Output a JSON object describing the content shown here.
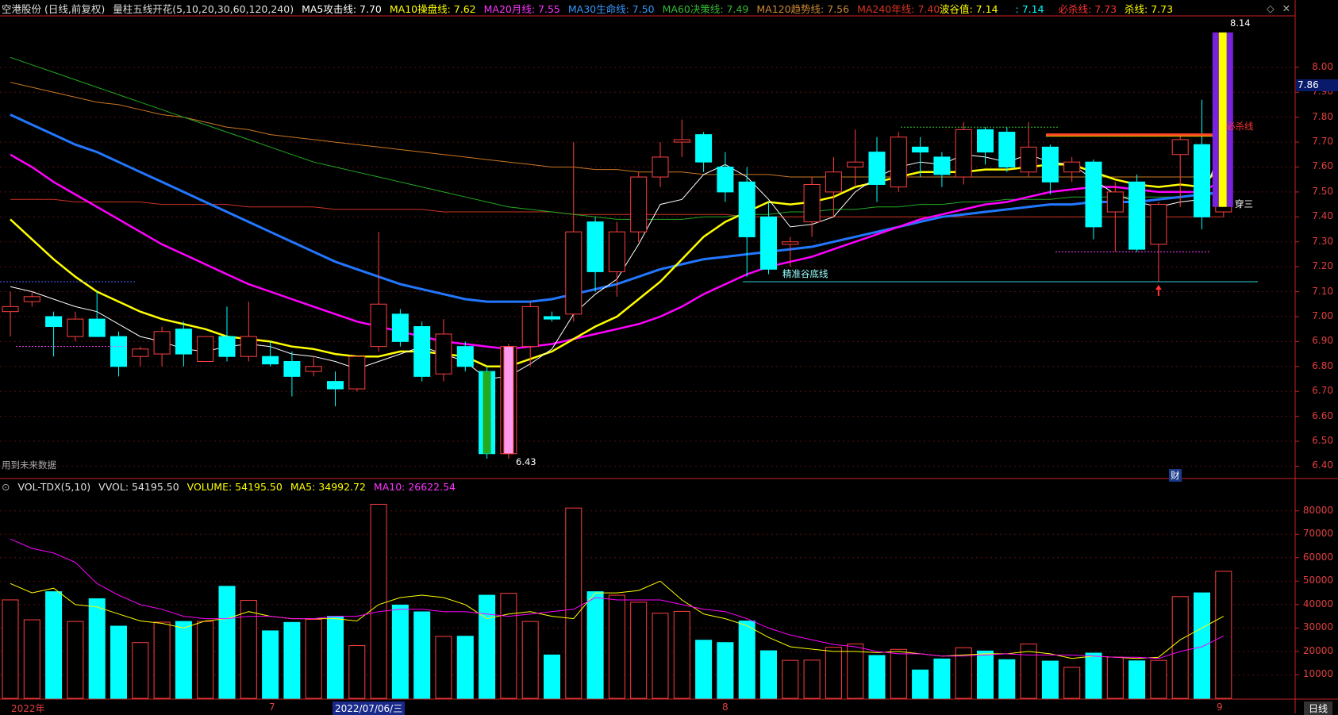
{
  "main_header": {
    "stock": "空港股份 (日线,前复权)",
    "indicator": "量柱五线开花(5,10,20,30,60,120,240)",
    "ma5": "MA5攻击线: 7.70",
    "ma10": "MA10操盘线: 7.62",
    "ma20": "MA20月线: 7.55",
    "ma30": "MA30生命线: 7.50",
    "ma60": "MA60决策线: 7.49",
    "ma120": "MA120趋势线: 7.56",
    "ma240": "MA240年线: 7.40",
    "wave_value": "波谷值: 7.14",
    "blank_value": ": 7.14",
    "must_kill": "必杀线: 7.73",
    "kill": "杀线: 7.73"
  },
  "vol_header": {
    "name": "VOL-TDX(5,10)",
    "vvol": "VVOL: 54195.50",
    "volume": "VOLUME: 54195.50",
    "ma5": "MA5: 34992.72",
    "ma10": "MA10: 26622.54"
  },
  "price_axis": [
    "8.00",
    "7.90",
    "7.80",
    "7.70",
    "7.60",
    "7.50",
    "7.40",
    "7.30",
    "7.20",
    "7.10",
    "7.00",
    "6.90",
    "6.80",
    "6.70",
    "6.60",
    "6.50",
    "6.40"
  ],
  "current_price": "7.86",
  "vol_axis": [
    "80000",
    "70000",
    "60000",
    "50000",
    "40000",
    "30000",
    "20000",
    "10000"
  ],
  "annotations": {
    "high": "8.14",
    "low": "6.43",
    "must_kill_line": "必杀线",
    "cross_three": "穿三",
    "valley_line": "精准谷底线",
    "future_data": "用到未来数据",
    "finance": "财"
  },
  "date_labels": {
    "year": "2022年",
    "july": "7",
    "cursor_date": "2022/07/06/三",
    "aug": "8",
    "sep": "9"
  },
  "tab_label": "日线",
  "colors": {
    "up": "#ff4040",
    "down": "#00ffff",
    "ma5": "#ffffff",
    "ma10": "#ffff00",
    "ma20": "#ff00ff",
    "ma30": "#2277ff",
    "ma60": "#22aa22",
    "ma120": "#cc7722",
    "ma240": "#cc3322",
    "axis": "#cc2222"
  },
  "chart_data": {
    "type": "candlestick",
    "price_range": [
      6.36,
      8.2
    ],
    "volume_range": [
      0,
      86000
    ],
    "candles": [
      {
        "o": 7.02,
        "h": 7.1,
        "l": 6.92,
        "c": 7.04,
        "v": 42000
      },
      {
        "o": 7.06,
        "h": 7.1,
        "l": 7.04,
        "c": 7.08,
        "v": 33500
      },
      {
        "o": 7.0,
        "h": 7.02,
        "l": 6.84,
        "c": 6.96,
        "v": 45500
      },
      {
        "o": 6.92,
        "h": 7.02,
        "l": 6.9,
        "c": 6.99,
        "v": 32800
      },
      {
        "o": 6.99,
        "h": 7.1,
        "l": 6.92,
        "c": 6.92,
        "v": 42500
      },
      {
        "o": 6.92,
        "h": 6.94,
        "l": 6.76,
        "c": 6.8,
        "v": 30800
      },
      {
        "o": 6.84,
        "h": 6.88,
        "l": 6.8,
        "c": 6.87,
        "v": 23800
      },
      {
        "o": 6.85,
        "h": 6.96,
        "l": 6.8,
        "c": 6.94,
        "v": 32500
      },
      {
        "o": 6.95,
        "h": 6.98,
        "l": 6.8,
        "c": 6.85,
        "v": 32800
      },
      {
        "o": 6.82,
        "h": 6.92,
        "l": 6.82,
        "c": 6.92,
        "v": 32800
      },
      {
        "o": 6.92,
        "h": 7.04,
        "l": 6.82,
        "c": 6.84,
        "v": 47800
      },
      {
        "o": 6.84,
        "h": 7.06,
        "l": 6.82,
        "c": 6.92,
        "v": 41800
      },
      {
        "o": 6.84,
        "h": 6.9,
        "l": 6.8,
        "c": 6.81,
        "v": 28800
      },
      {
        "o": 6.82,
        "h": 6.86,
        "l": 6.68,
        "c": 6.76,
        "v": 32400
      },
      {
        "o": 6.78,
        "h": 6.84,
        "l": 6.76,
        "c": 6.8,
        "v": 33700
      },
      {
        "o": 6.74,
        "h": 6.78,
        "l": 6.64,
        "c": 6.71,
        "v": 35000
      },
      {
        "o": 6.71,
        "h": 6.84,
        "l": 6.7,
        "c": 6.84,
        "v": 22500
      },
      {
        "o": 6.88,
        "h": 7.34,
        "l": 6.86,
        "c": 7.05,
        "v": 82800
      },
      {
        "o": 7.01,
        "h": 7.03,
        "l": 6.88,
        "c": 6.9,
        "v": 39800
      },
      {
        "o": 6.96,
        "h": 6.98,
        "l": 6.74,
        "c": 6.76,
        "v": 36900
      },
      {
        "o": 6.77,
        "h": 6.99,
        "l": 6.74,
        "c": 6.93,
        "v": 26400
      },
      {
        "o": 6.88,
        "h": 6.9,
        "l": 6.78,
        "c": 6.8,
        "v": 26500
      },
      {
        "o": 6.78,
        "h": 6.8,
        "l": 6.43,
        "c": 6.45,
        "v": 44000
      },
      {
        "o": 6.45,
        "h": 6.89,
        "l": 6.43,
        "c": 6.88,
        "v": 44800
      },
      {
        "o": 6.88,
        "h": 7.06,
        "l": 6.8,
        "c": 7.04,
        "v": 32800
      },
      {
        "o": 7.0,
        "h": 7.02,
        "l": 6.98,
        "c": 6.99,
        "v": 18500
      },
      {
        "o": 7.01,
        "h": 7.7,
        "l": 6.98,
        "c": 7.34,
        "v": 81200
      },
      {
        "o": 7.38,
        "h": 7.4,
        "l": 7.1,
        "c": 7.18,
        "v": 45500
      },
      {
        "o": 7.18,
        "h": 7.38,
        "l": 7.08,
        "c": 7.34,
        "v": 44000
      },
      {
        "o": 7.34,
        "h": 7.58,
        "l": 7.3,
        "c": 7.56,
        "v": 41000
      },
      {
        "o": 7.56,
        "h": 7.7,
        "l": 7.52,
        "c": 7.64,
        "v": 36300
      },
      {
        "o": 7.7,
        "h": 7.79,
        "l": 7.64,
        "c": 7.71,
        "v": 37100
      },
      {
        "o": 7.73,
        "h": 7.74,
        "l": 7.58,
        "c": 7.62,
        "v": 24800
      },
      {
        "o": 7.6,
        "h": 7.66,
        "l": 7.46,
        "c": 7.5,
        "v": 23800
      },
      {
        "o": 7.54,
        "h": 7.6,
        "l": 7.16,
        "c": 7.32,
        "v": 33000
      },
      {
        "o": 7.4,
        "h": 7.46,
        "l": 7.17,
        "c": 7.19,
        "v": 20300
      },
      {
        "o": 7.29,
        "h": 7.32,
        "l": 7.2,
        "c": 7.3,
        "v": 16200
      },
      {
        "o": 7.38,
        "h": 7.56,
        "l": 7.32,
        "c": 7.53,
        "v": 16300
      },
      {
        "o": 7.5,
        "h": 7.64,
        "l": 7.4,
        "c": 7.58,
        "v": 21800
      },
      {
        "o": 7.6,
        "h": 7.75,
        "l": 7.52,
        "c": 7.62,
        "v": 23200
      },
      {
        "o": 7.66,
        "h": 7.72,
        "l": 7.46,
        "c": 7.53,
        "v": 18300
      },
      {
        "o": 7.52,
        "h": 7.74,
        "l": 7.5,
        "c": 7.72,
        "v": 20900
      },
      {
        "o": 7.68,
        "h": 7.72,
        "l": 7.56,
        "c": 7.66,
        "v": 12100
      },
      {
        "o": 7.64,
        "h": 7.66,
        "l": 7.52,
        "c": 7.57,
        "v": 16800
      },
      {
        "o": 7.56,
        "h": 7.78,
        "l": 7.53,
        "c": 7.75,
        "v": 21600
      },
      {
        "o": 7.75,
        "h": 7.76,
        "l": 7.61,
        "c": 7.66,
        "v": 20200
      },
      {
        "o": 7.74,
        "h": 7.76,
        "l": 7.58,
        "c": 7.6,
        "v": 16500
      },
      {
        "o": 7.58,
        "h": 7.78,
        "l": 7.56,
        "c": 7.68,
        "v": 23200
      },
      {
        "o": 7.68,
        "h": 7.69,
        "l": 7.49,
        "c": 7.54,
        "v": 15900
      },
      {
        "o": 7.58,
        "h": 7.64,
        "l": 7.54,
        "c": 7.62,
        "v": 13200
      },
      {
        "o": 7.62,
        "h": 7.63,
        "l": 7.31,
        "c": 7.36,
        "v": 19300
      },
      {
        "o": 7.42,
        "h": 7.54,
        "l": 7.26,
        "c": 7.5,
        "v": 17600
      },
      {
        "o": 7.54,
        "h": 7.57,
        "l": 7.26,
        "c": 7.27,
        "v": 16000
      },
      {
        "o": 7.29,
        "h": 7.46,
        "l": 7.14,
        "c": 7.45,
        "v": 16200
      },
      {
        "o": 7.65,
        "h": 7.73,
        "l": 7.44,
        "c": 7.71,
        "v": 43400
      },
      {
        "o": 7.69,
        "h": 7.87,
        "l": 7.35,
        "c": 7.4,
        "v": 45000
      },
      {
        "o": 7.42,
        "h": 8.14,
        "l": 7.4,
        "c": 8.13,
        "v": 54195.5
      }
    ],
    "ma5": [
      7.12,
      7.1,
      7.07,
      7.04,
      7.02,
      6.97,
      6.92,
      6.9,
      6.87,
      6.86,
      6.88,
      6.89,
      6.88,
      6.85,
      6.84,
      6.82,
      6.79,
      6.82,
      6.85,
      6.88,
      6.85,
      6.82,
      6.75,
      6.76,
      6.81,
      6.87,
      7.01,
      7.09,
      7.15,
      7.29,
      7.45,
      7.47,
      7.57,
      7.61,
      7.56,
      7.47,
      7.36,
      7.37,
      7.4,
      7.5,
      7.56,
      7.6,
      7.62,
      7.61,
      7.65,
      7.64,
      7.62,
      7.65,
      7.62,
      7.61,
      7.55,
      7.49,
      7.46,
      7.44,
      7.46,
      7.47,
      7.7
    ],
    "ma10": [
      7.39,
      7.31,
      7.23,
      7.16,
      7.1,
      7.06,
      7.02,
      6.99,
      6.97,
      6.95,
      6.92,
      6.91,
      6.9,
      6.88,
      6.87,
      6.85,
      6.84,
      6.84,
      6.86,
      6.86,
      6.85,
      6.84,
      6.8,
      6.8,
      6.83,
      6.86,
      6.91,
      6.96,
      7.0,
      7.07,
      7.14,
      7.23,
      7.32,
      7.38,
      7.42,
      7.46,
      7.45,
      7.46,
      7.48,
      7.52,
      7.54,
      7.56,
      7.58,
      7.58,
      7.58,
      7.59,
      7.59,
      7.6,
      7.61,
      7.61,
      7.58,
      7.55,
      7.53,
      7.52,
      7.53,
      7.52,
      7.62
    ],
    "ma20": [
      7.65,
      7.6,
      7.54,
      7.49,
      7.44,
      7.39,
      7.34,
      7.29,
      7.25,
      7.21,
      7.17,
      7.13,
      7.1,
      7.07,
      7.04,
      7.01,
      6.98,
      6.96,
      6.94,
      6.92,
      6.9,
      6.89,
      6.88,
      6.87,
      6.88,
      6.89,
      6.91,
      6.93,
      6.95,
      6.97,
      7.0,
      7.04,
      7.09,
      7.13,
      7.17,
      7.2,
      7.22,
      7.24,
      7.27,
      7.3,
      7.33,
      7.36,
      7.39,
      7.41,
      7.43,
      7.45,
      7.46,
      7.48,
      7.5,
      7.51,
      7.52,
      7.52,
      7.51,
      7.5,
      7.5,
      7.5,
      7.55
    ],
    "ma30": [
      7.81,
      7.77,
      7.73,
      7.69,
      7.66,
      7.62,
      7.58,
      7.54,
      7.5,
      7.46,
      7.42,
      7.38,
      7.34,
      7.3,
      7.26,
      7.22,
      7.19,
      7.16,
      7.13,
      7.11,
      7.09,
      7.07,
      7.06,
      7.06,
      7.06,
      7.07,
      7.09,
      7.11,
      7.13,
      7.16,
      7.19,
      7.21,
      7.23,
      7.24,
      7.25,
      7.26,
      7.27,
      7.28,
      7.3,
      7.32,
      7.34,
      7.36,
      7.38,
      7.4,
      7.41,
      7.42,
      7.43,
      7.44,
      7.45,
      7.45,
      7.46,
      7.46,
      7.46,
      7.47,
      7.48,
      7.49,
      7.5
    ],
    "ma60": [
      8.04,
      8.01,
      7.98,
      7.95,
      7.92,
      7.89,
      7.86,
      7.83,
      7.8,
      7.77,
      7.74,
      7.71,
      7.68,
      7.65,
      7.62,
      7.6,
      7.58,
      7.56,
      7.54,
      7.52,
      7.5,
      7.48,
      7.46,
      7.44,
      7.43,
      7.42,
      7.41,
      7.4,
      7.39,
      7.39,
      7.39,
      7.39,
      7.4,
      7.4,
      7.41,
      7.41,
      7.42,
      7.42,
      7.43,
      7.43,
      7.44,
      7.44,
      7.45,
      7.45,
      7.46,
      7.46,
      7.47,
      7.47,
      7.47,
      7.48,
      7.48,
      7.48,
      7.48,
      7.48,
      7.48,
      7.49,
      7.49
    ],
    "ma120": [
      7.94,
      7.92,
      7.9,
      7.88,
      7.86,
      7.85,
      7.83,
      7.81,
      7.8,
      7.78,
      7.76,
      7.75,
      7.73,
      7.72,
      7.71,
      7.7,
      7.69,
      7.68,
      7.67,
      7.66,
      7.65,
      7.64,
      7.63,
      7.62,
      7.61,
      7.6,
      7.6,
      7.59,
      7.59,
      7.58,
      7.58,
      7.58,
      7.57,
      7.57,
      7.57,
      7.57,
      7.56,
      7.56,
      7.56,
      7.56,
      7.56,
      7.56,
      7.56,
      7.56,
      7.56,
      7.56,
      7.56,
      7.56,
      7.56,
      7.56,
      7.56,
      7.56,
      7.56,
      7.56,
      7.56,
      7.56,
      7.56
    ],
    "ma240": [
      7.47,
      7.47,
      7.47,
      7.46,
      7.46,
      7.46,
      7.46,
      7.45,
      7.45,
      7.45,
      7.45,
      7.44,
      7.44,
      7.44,
      7.44,
      7.43,
      7.43,
      7.43,
      7.43,
      7.43,
      7.42,
      7.42,
      7.42,
      7.42,
      7.42,
      7.42,
      7.41,
      7.41,
      7.41,
      7.41,
      7.41,
      7.41,
      7.41,
      7.41,
      7.4,
      7.4,
      7.4,
      7.4,
      7.4,
      7.4,
      7.4,
      7.4,
      7.4,
      7.4,
      7.4,
      7.4,
      7.4,
      7.4,
      7.4,
      7.4,
      7.4,
      7.4,
      7.4,
      7.4,
      7.4,
      7.4,
      7.4
    ],
    "vol_ma5": [
      49000,
      45000,
      47000,
      40000,
      39000,
      36000,
      33000,
      32000,
      30000,
      33000,
      34000,
      37000,
      35000,
      34000,
      34000,
      34000,
      33000,
      40000,
      43000,
      44000,
      43000,
      40000,
      34000,
      36000,
      37000,
      35000,
      34000,
      45000,
      45000,
      46000,
      50000,
      42000,
      36000,
      34000,
      31000,
      26000,
      22000,
      21000,
      20000,
      20000,
      19500,
      20000,
      19000,
      18000,
      18500,
      19000,
      19000,
      20000,
      19000,
      17000,
      18000,
      17500,
      17000,
      17500,
      25000,
      30000,
      34992.72
    ],
    "vol_ma10": [
      68000,
      64000,
      62000,
      58000,
      49000,
      44000,
      40000,
      38000,
      35000,
      34000,
      34000,
      35000,
      35000,
      34000,
      34000,
      35000,
      35000,
      37000,
      38000,
      38000,
      37000,
      37000,
      36000,
      35000,
      36000,
      37000,
      38000,
      43000,
      42000,
      42000,
      42000,
      40000,
      38000,
      37000,
      34000,
      30000,
      27000,
      25000,
      23000,
      22000,
      20000,
      19000,
      19000,
      18000,
      18000,
      18500,
      19000,
      18500,
      18500,
      18500,
      18000,
      17500,
      17500,
      17000,
      20000,
      22000,
      26622.54
    ]
  }
}
